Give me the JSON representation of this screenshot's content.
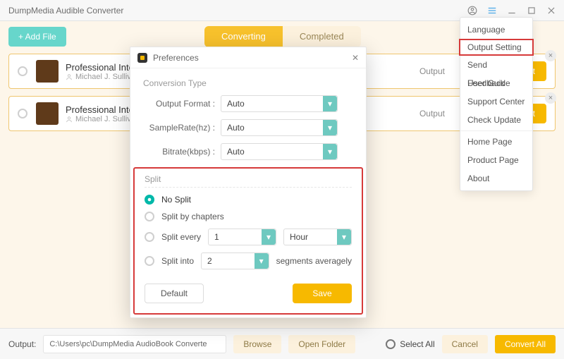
{
  "app": {
    "title": "DumpMedia Audible Converter"
  },
  "toolbar": {
    "add_file": "+ Add File"
  },
  "tabs": {
    "converting": "Converting",
    "completed": "Completed"
  },
  "items": [
    {
      "title": "Professional Integrity (A",
      "author": "Michael J. Sullivan",
      "output_label": "Output",
      "convert": "Convert"
    },
    {
      "title": "Professional Integrity (A",
      "author": "Michael J. Sullivan",
      "output_label": "Output",
      "convert": "Convert"
    }
  ],
  "menu": {
    "language": "Language",
    "output_setting": "Output Setting",
    "send_feedback": "Send Feedback",
    "user_guide": "User Guide",
    "support_center": "Support Center",
    "check_update": "Check Update",
    "home_page": "Home Page",
    "product_page": "Product Page",
    "about": "About"
  },
  "prefs": {
    "title": "Preferences",
    "conversion_type": "Conversion Type",
    "output_format": "Output Format :",
    "samplerate": "SampleRate(hz) :",
    "bitrate": "Bitrate(kbps) :",
    "auto": "Auto",
    "split_title": "Split",
    "no_split": "No Split",
    "by_chapters": "Split by chapters",
    "split_every": "Split every",
    "split_every_n": "1",
    "split_every_unit": "Hour",
    "split_into": "Split into",
    "split_into_n": "2",
    "split_into_tail": "segments averagely",
    "default": "Default",
    "save": "Save"
  },
  "bottom": {
    "output_label": "Output:",
    "path": "C:\\Users\\pc\\DumpMedia AudioBook Converte",
    "browse": "Browse",
    "open_folder": "Open Folder",
    "select_all": "Select All",
    "cancel": "Cancel",
    "convert_all": "Convert All"
  }
}
